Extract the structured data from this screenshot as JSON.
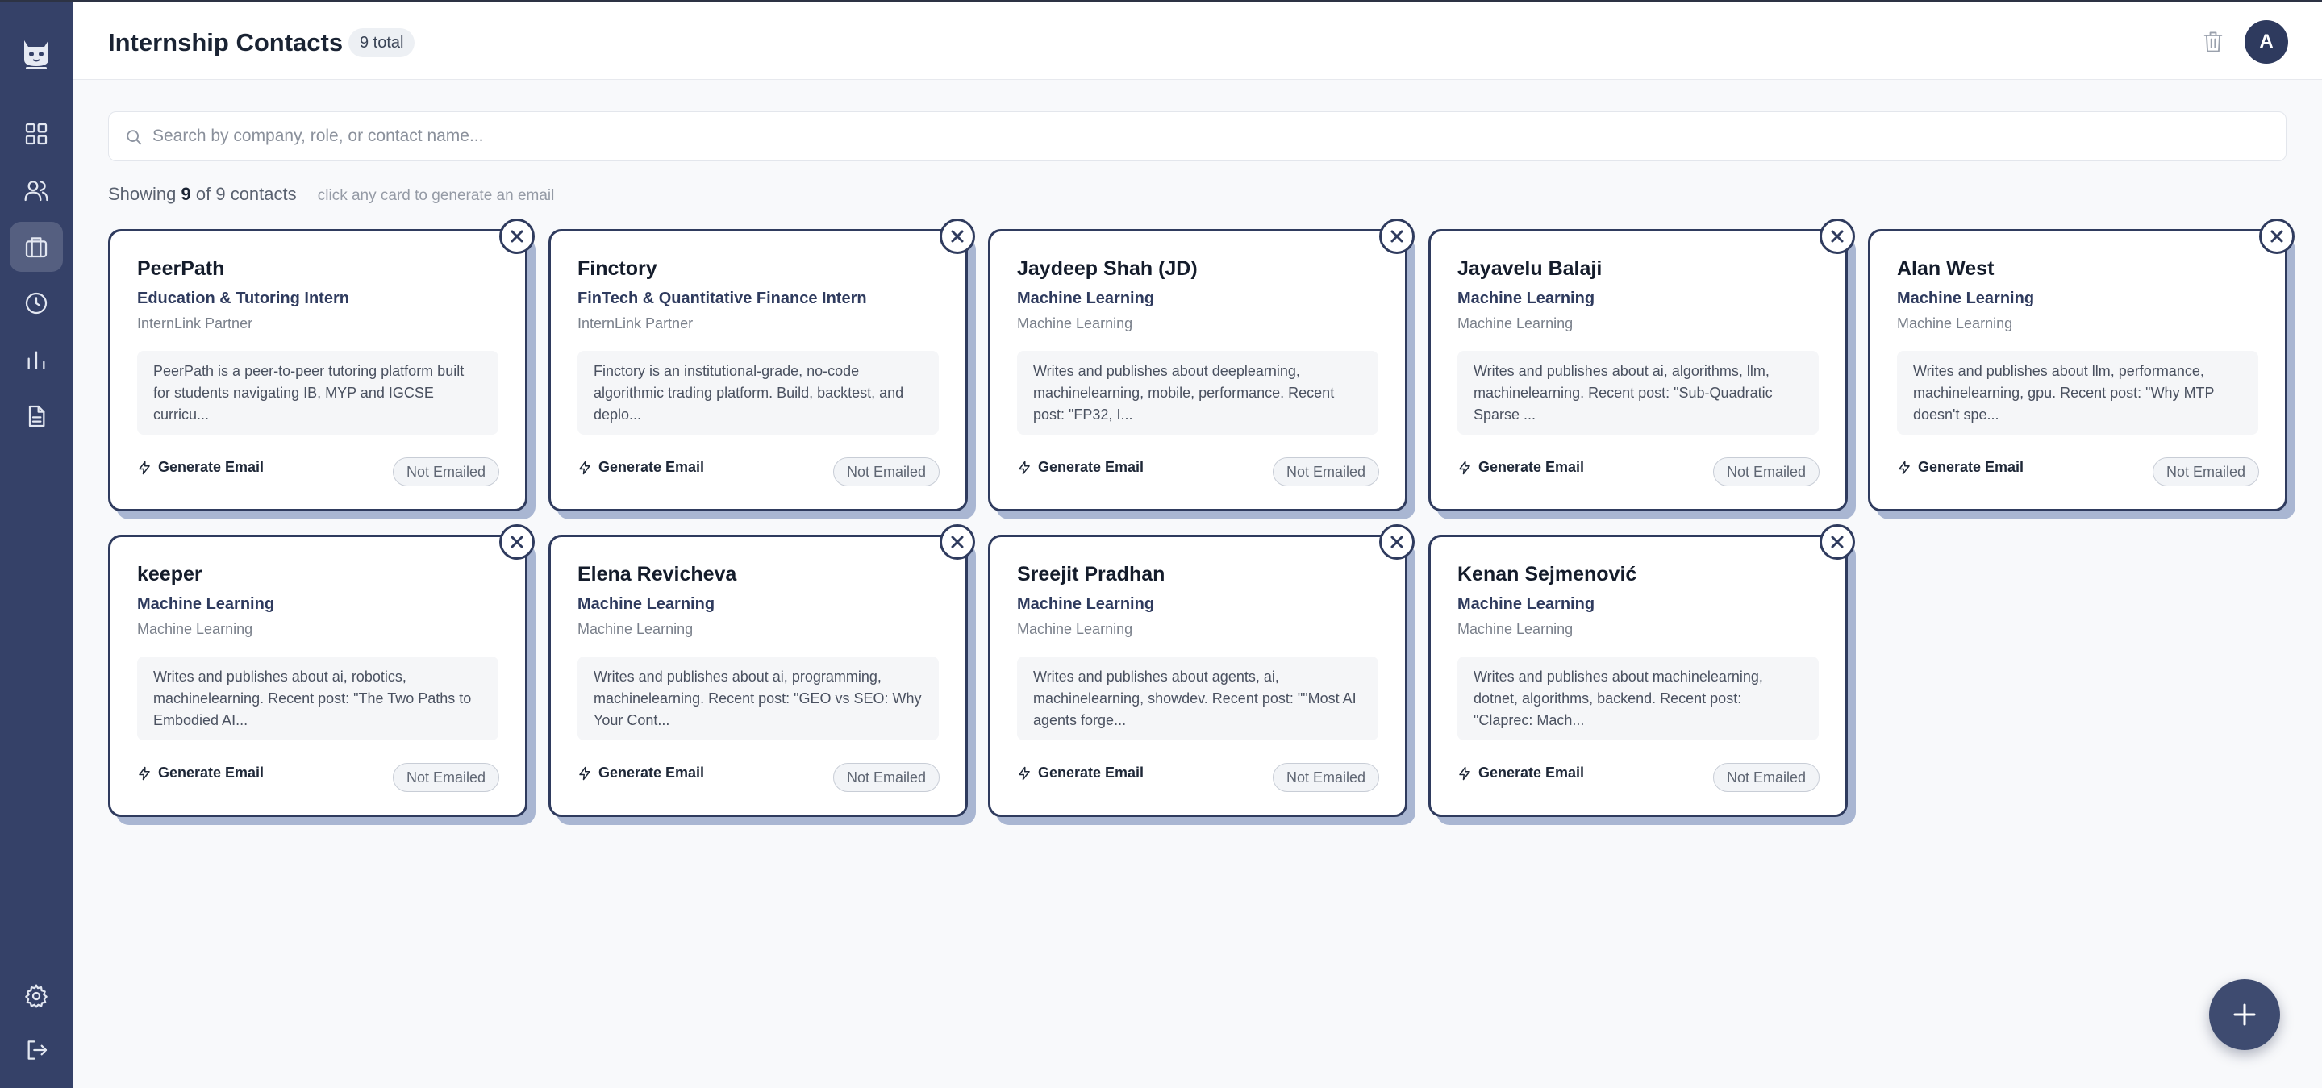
{
  "header": {
    "title": "Internship Contacts",
    "count_badge": "9 total",
    "avatar_initial": "A",
    "trash_icon": "trash-icon"
  },
  "sidebar": {
    "logo_icon": "cat-logo-icon",
    "items": [
      {
        "icon": "grid-icon",
        "active": false
      },
      {
        "icon": "users-icon",
        "active": false
      },
      {
        "icon": "briefcase-icon",
        "active": true
      },
      {
        "icon": "clock-icon",
        "active": false
      },
      {
        "icon": "bar-chart-icon",
        "active": false
      },
      {
        "icon": "document-icon",
        "active": false
      }
    ],
    "bottom": [
      {
        "icon": "settings-icon"
      },
      {
        "icon": "logout-icon"
      }
    ]
  },
  "search": {
    "placeholder": "Search by company, role, or contact name...",
    "value": ""
  },
  "summary": {
    "prefix": "Showing",
    "shown": "9",
    "middle": "of 9 contacts",
    "hint": "click any card to generate an email"
  },
  "cards": [
    {
      "name": "PeerPath",
      "role": "Education & Tutoring Intern",
      "subtitle": "InternLink Partner",
      "description": "PeerPath is a peer-to-peer tutoring platform built for students navigating IB, MYP and IGCSE curricu...",
      "action": "Generate Email",
      "status": "Not Emailed"
    },
    {
      "name": "Finctory",
      "role": "FinTech & Quantitative Finance Intern",
      "subtitle": "InternLink Partner",
      "description": "Finctory is an institutional-grade, no-code algorithmic trading platform. Build, backtest, and deplo...",
      "action": "Generate Email",
      "status": "Not Emailed"
    },
    {
      "name": "Jaydeep Shah (JD)",
      "role": "Machine Learning",
      "subtitle": "Machine Learning",
      "description": "Writes and publishes about deeplearning, machinelearning, mobile, performance. Recent post: \"FP32, I...",
      "action": "Generate Email",
      "status": "Not Emailed"
    },
    {
      "name": "Jayavelu Balaji",
      "role": "Machine Learning",
      "subtitle": "Machine Learning",
      "description": "Writes and publishes about ai, algorithms, llm, machinelearning. Recent post: \"Sub-Quadratic Sparse ...",
      "action": "Generate Email",
      "status": "Not Emailed"
    },
    {
      "name": "Alan West",
      "role": "Machine Learning",
      "subtitle": "Machine Learning",
      "description": "Writes and publishes about llm, performance, machinelearning, gpu. Recent post: \"Why MTP doesn't spe...",
      "action": "Generate Email",
      "status": "Not Emailed"
    },
    {
      "name": "keeper",
      "role": "Machine Learning",
      "subtitle": "Machine Learning",
      "description": "Writes and publishes about ai, robotics, machinelearning. Recent post: \"The Two Paths to Embodied AI...",
      "action": "Generate Email",
      "status": "Not Emailed"
    },
    {
      "name": "Elena Revicheva",
      "role": "Machine Learning",
      "subtitle": "Machine Learning",
      "description": "Writes and publishes about ai, programming, machinelearning. Recent post: \"GEO vs SEO: Why Your Cont...",
      "action": "Generate Email",
      "status": "Not Emailed"
    },
    {
      "name": "Sreejit Pradhan",
      "role": "Machine Learning",
      "subtitle": "Machine Learning",
      "description": "Writes and publishes about agents, ai, machinelearning, showdev. Recent post: \"\"Most AI agents forge...",
      "action": "Generate Email",
      "status": "Not Emailed"
    },
    {
      "name": "Kenan Sejmenović",
      "role": "Machine Learning",
      "subtitle": "Machine Learning",
      "description": "Writes and publishes about machinelearning, dotnet, algorithms, backend. Recent post: \"Claprec: Mach...",
      "action": "Generate Email",
      "status": "Not Emailed"
    }
  ],
  "fab": {
    "icon": "plus-icon"
  },
  "colors": {
    "sidebar": "#354168",
    "card_border": "#2f3b5e",
    "card_shadow": "#a9b6d2",
    "background": "#f8f9fb"
  }
}
